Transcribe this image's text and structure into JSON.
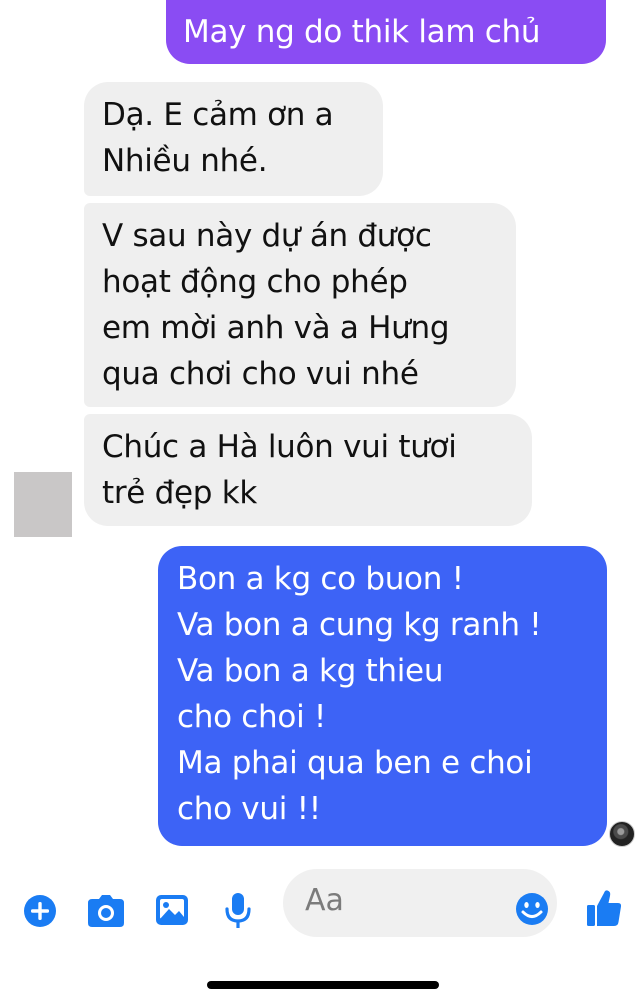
{
  "messages": [
    {
      "id": "m1",
      "direction": "sent",
      "text": "May ng do thik lam chủ"
    },
    {
      "id": "m2",
      "direction": "received",
      "text": "Dạ. E cảm ơn a\nNhiều nhé."
    },
    {
      "id": "m3",
      "direction": "received",
      "text": "V sau này dự án được\nhoạt động cho phép\nem mời anh và a Hưng\nqua chơi cho vui nhé"
    },
    {
      "id": "m4",
      "direction": "received",
      "text": "Chúc a Hà luôn vui tươi\ntrẻ đẹp kk"
    },
    {
      "id": "m5",
      "direction": "sent",
      "text": "Bon a kg co buon !\nVa bon a cung kg ranh !\nVa bon a kg thieu\ncho choi !\nMa phai qua ben e choi\ncho vui !!"
    }
  ],
  "composer": {
    "placeholder": "Aa",
    "icons": [
      "plus-icon",
      "camera-icon",
      "image-icon",
      "microphone-icon",
      "emoji-icon",
      "thumbs-up-icon"
    ]
  },
  "colors": {
    "sent_gradient_top": "#8a4cf3",
    "sent_bubble": "#3d63f6",
    "received_bubble": "#efefef",
    "icon_blue": "#1a7cf3"
  }
}
